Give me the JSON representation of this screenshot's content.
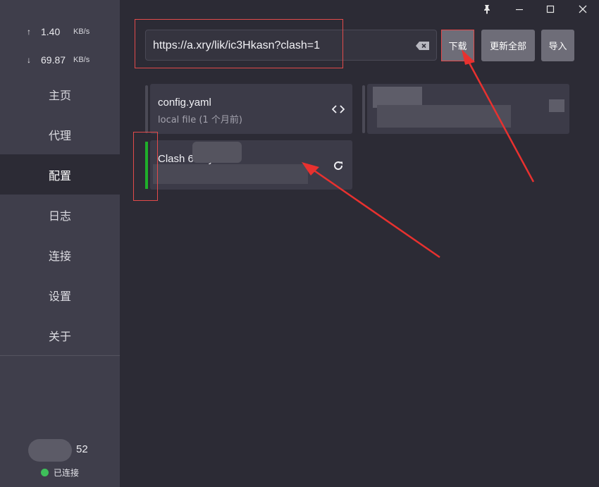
{
  "window": {
    "pin_icon": "pin-icon",
    "minimize_icon": "minimize-icon",
    "maximize_icon": "maximize-icon",
    "close_icon": "close-icon"
  },
  "traffic": {
    "upload": {
      "arrow": "↑",
      "value": "1.40",
      "unit": "KB/s"
    },
    "download": {
      "arrow": "↓",
      "value": "69.87",
      "unit": "KB/s"
    }
  },
  "nav": {
    "items": [
      {
        "label": "主页"
      },
      {
        "label": "代理"
      },
      {
        "label": "配置"
      },
      {
        "label": "日志"
      },
      {
        "label": "连接"
      },
      {
        "label": "设置"
      },
      {
        "label": "关于"
      }
    ],
    "active": "配置"
  },
  "footer": {
    "count": "52",
    "status": "已连接",
    "status_color": "#3ec05a"
  },
  "toolbar": {
    "url_value": "https://a.xry/lik/ic3Hkasn?clash=1",
    "download_label": "下载",
    "update_all_label": "更新全部",
    "import_label": "导入"
  },
  "profiles": [
    {
      "title": "config.yaml",
      "subtitle": "local file (1 个月前)",
      "action_icon": "code-icon"
    },
    {
      "title": "",
      "subtitle": "",
      "action_icon": ""
    },
    {
      "title": "Clash          607.yaml",
      "subtitle": "",
      "action_icon": "refresh-icon",
      "active_color": "#1fae2a"
    }
  ],
  "colors": {
    "sidebar_bg": "#3f3e4b",
    "content_bg": "#2c2b35",
    "card_bg": "#3c3b48",
    "button_bg": "#6e6d78",
    "annotation_red": "#e24b4b"
  }
}
